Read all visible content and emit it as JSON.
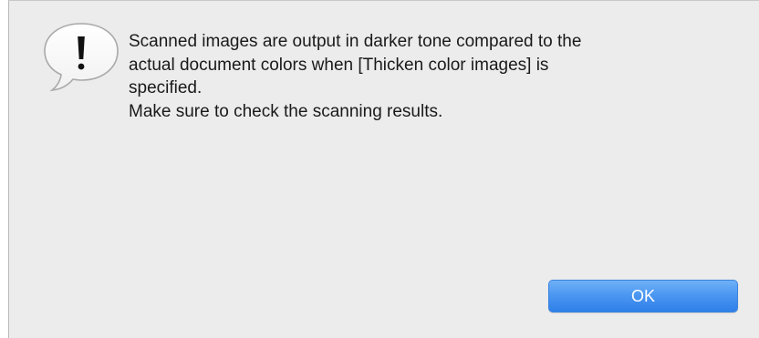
{
  "dialog": {
    "icon": "exclamation-speech-bubble-icon",
    "message_lines": [
      "Scanned images are output in darker tone compared to the",
      "actual document colors when [Thicken color images] is",
      "specified.",
      "Make sure to check the scanning results."
    ],
    "ok_label": "OK"
  },
  "colors": {
    "dialog_background": "#ececec",
    "button_accent": "#4a96f1",
    "button_text": "#ffffff",
    "text": "#1a1a1a"
  }
}
